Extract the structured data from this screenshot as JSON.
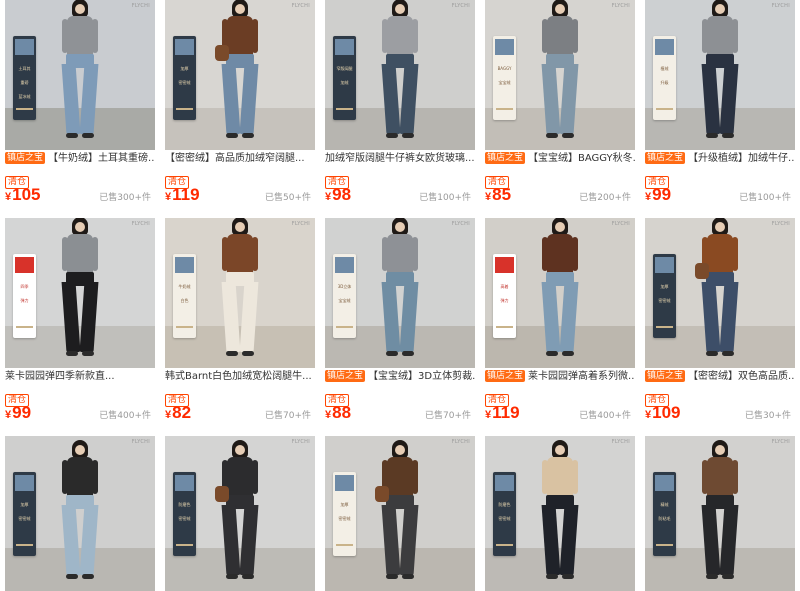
{
  "brand_mark": "FLYCHI",
  "tags": {
    "shop": "镇店之宝",
    "clearance": "清仓"
  },
  "currency": "¥",
  "products": [
    {
      "shop_tag": true,
      "title": "【牛奶绒】土耳其重磅...",
      "price": "105",
      "sold": "已售300+件",
      "wall": "#c9ccd0",
      "floor": "#a9aaa6",
      "top": "#8f9296",
      "jeans": "#7e9bb8",
      "panel": "dark",
      "bag": false,
      "panel_text": [
        "土耳其",
        "重磅",
        "蓝冰绒"
      ]
    },
    {
      "shop_tag": false,
      "title": "【密密绒】高品质加绒窄阔腿...",
      "price": "119",
      "sold": "已售50+件",
      "wall": "#d8d6d2",
      "floor": "#c6c2bc",
      "top": "#6b3d24",
      "jeans": "#6f8aa6",
      "panel": "dark",
      "bag": true,
      "panel_text": [
        "加厚",
        "密密绒"
      ]
    },
    {
      "shop_tag": false,
      "title": "加绒窄版阔腿牛仔裤女欧货玻璃...",
      "price": "98",
      "sold": "已售100+件",
      "wall": "#cfcfcd",
      "floor": "#b7b5b0",
      "top": "#9c9ea2",
      "jeans": "#3f5062",
      "panel": "dark",
      "bag": false,
      "panel_text": [
        "窄版阔腿",
        "加绒"
      ]
    },
    {
      "shop_tag": true,
      "title": "【宝宝绒】BAGGY秋冬...",
      "price": "85",
      "sold": "已售200+件",
      "wall": "#d6d4d0",
      "floor": "#c2beb7",
      "top": "#7c7f83",
      "jeans": "#8197a8",
      "panel": "light",
      "bag": false,
      "panel_text": [
        "BAGGY",
        "宝宝绒"
      ]
    },
    {
      "shop_tag": true,
      "title": "【升级植绒】加绒牛仔...",
      "price": "99",
      "sold": "已售100+件",
      "wall": "#cdd0d2",
      "floor": "#b8b7b3",
      "top": "#8d9094",
      "jeans": "#2a3241",
      "panel": "light",
      "bag": false,
      "panel_text": [
        "植绒",
        "升级"
      ]
    },
    {
      "shop_tag": false,
      "title": "莱卡园园弹四季新款直...",
      "price": "99",
      "sold": "已售400+件",
      "wall": "#d4d5d5",
      "floor": "#c0bfbb",
      "top": "#8b8f93",
      "jeans": "#1d1d1f",
      "panel": "red",
      "bag": false,
      "panel_text": [
        "四季",
        "弹力"
      ]
    },
    {
      "shop_tag": false,
      "title": "韩式Barnt白色加绒宽松阔腿牛...",
      "price": "82",
      "sold": "已售70+件",
      "wall": "#d9d4cc",
      "floor": "#c7c0b4",
      "top": "#7b4628",
      "jeans": "#ede7dc",
      "panel": "light",
      "bag": false,
      "panel_text": [
        "牛奶绒",
        "白色"
      ]
    },
    {
      "shop_tag": true,
      "title": "【宝宝绒】3D立体剪裁...",
      "price": "88",
      "sold": "已售70+件",
      "wall": "#d1d2d1",
      "floor": "#bbb8b2",
      "top": "#8e9196",
      "jeans": "#6f8da3",
      "panel": "light",
      "bag": false,
      "panel_text": [
        "3D立体",
        "宝宝绒"
      ]
    },
    {
      "shop_tag": true,
      "title": "莱卡园园弹高着系列微...",
      "price": "119",
      "sold": "已售400+件",
      "wall": "#d2cfc9",
      "floor": "#bcb7ae",
      "top": "#5e3220",
      "jeans": "#7f9cb4",
      "panel": "red",
      "bag": false,
      "panel_text": [
        "高着",
        "弹力"
      ]
    },
    {
      "shop_tag": true,
      "title": "【密密绒】双色高品质...",
      "price": "109",
      "sold": "已售30+件",
      "wall": "#d6d3ce",
      "floor": "#c3beb6",
      "top": "#8a4a22",
      "jeans": "#3d4e68",
      "panel": "dark",
      "bag": true,
      "panel_text": [
        "加厚",
        "密密绒"
      ]
    },
    {
      "shop_tag": false,
      "title": "",
      "price": "",
      "sold": "",
      "wall": "#cfcfce",
      "floor": "#b9b7b2",
      "top": "#2a2a2a",
      "jeans": "#9fb6c8",
      "panel": "dark",
      "bag": false,
      "panel_text": [
        "加厚",
        "密密绒"
      ]
    },
    {
      "shop_tag": false,
      "title": "",
      "price": "",
      "sold": "",
      "wall": "#d4d4d3",
      "floor": "#bdbbb6",
      "top": "#2c2c2e",
      "jeans": "#2f2f32",
      "panel": "dark",
      "bag": true,
      "panel_text": [
        "防磨色",
        "密密绒"
      ]
    },
    {
      "shop_tag": false,
      "title": "",
      "price": "",
      "sold": "",
      "wall": "#d0cfcc",
      "floor": "#bbb7b0",
      "top": "#5b3a24",
      "jeans": "#3c3c3e",
      "panel": "light",
      "bag": true,
      "panel_text": [
        "加厚",
        "密密绒"
      ]
    },
    {
      "shop_tag": false,
      "title": "",
      "price": "",
      "sold": "",
      "wall": "#d3d3d2",
      "floor": "#bdbab5",
      "top": "#d9c2a2",
      "jeans": "#1f2229",
      "panel": "dark",
      "bag": false,
      "panel_text": [
        "防磨色",
        "密密绒"
      ]
    },
    {
      "shop_tag": false,
      "title": "",
      "price": "",
      "sold": "",
      "wall": "#d2d1cf",
      "floor": "#bcb9b3",
      "top": "#6e4a32",
      "jeans": "#26272a",
      "panel": "dark",
      "bag": false,
      "panel_text": [
        "精绒",
        "防粘毛"
      ]
    }
  ]
}
